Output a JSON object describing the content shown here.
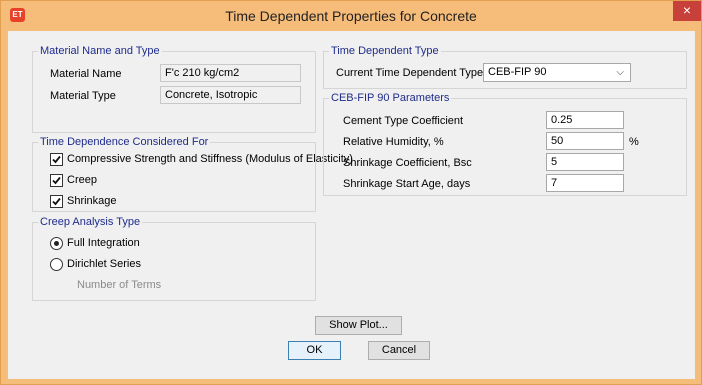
{
  "window": {
    "title": "Time Dependent Properties for Concrete",
    "app_icon": "ET",
    "close_glyph": "×"
  },
  "material": {
    "group_title": "Material Name and Type",
    "name_label": "Material Name",
    "name_value": "F'c 210 kg/cm2",
    "type_label": "Material Type",
    "type_value": "Concrete, Isotropic"
  },
  "time_dependence": {
    "group_title": "Time Dependence Considered For",
    "items": [
      {
        "label": "Compressive Strength and Stiffness  (Modulus of Elasticity)",
        "checked": true
      },
      {
        "label": "Creep",
        "checked": true
      },
      {
        "label": "Shrinkage",
        "checked": true
      }
    ]
  },
  "creep": {
    "group_title": "Creep Analysis Type",
    "options": [
      {
        "label": "Full Integration",
        "selected": true
      },
      {
        "label": "Dirichlet Series",
        "selected": false
      }
    ],
    "terms_label": "Number of Terms"
  },
  "tdtype": {
    "group_title": "Time Dependent Type",
    "label": "Current Time Dependent Type",
    "value": "CEB-FIP 90"
  },
  "params": {
    "group_title": "CEB-FIP 90 Parameters",
    "rows": [
      {
        "label": "Cement Type Coefficient",
        "value": "0.25",
        "unit": ""
      },
      {
        "label": "Relative Humidity, %",
        "value": "50",
        "unit": "%"
      },
      {
        "label": "Shrinkage Coefficient, Bsc",
        "value": "5",
        "unit": ""
      },
      {
        "label": "Shrinkage Start Age, days",
        "value": "7",
        "unit": ""
      }
    ]
  },
  "buttons": {
    "show_plot": "Show Plot...",
    "ok": "OK",
    "cancel": "Cancel"
  }
}
